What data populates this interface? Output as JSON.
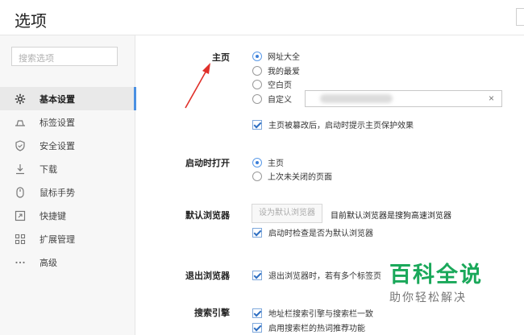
{
  "title": "选项",
  "search": {
    "placeholder": "搜索选项"
  },
  "sidebar": {
    "items": [
      {
        "label": "基本设置",
        "icon": "gear-icon",
        "active": true
      },
      {
        "label": "标签设置",
        "icon": "tab-icon",
        "active": false
      },
      {
        "label": "安全设置",
        "icon": "shield-icon",
        "active": false
      },
      {
        "label": "下载",
        "icon": "download-icon",
        "active": false
      },
      {
        "label": "鼠标手势",
        "icon": "mouse-icon",
        "active": false
      },
      {
        "label": "快捷键",
        "icon": "shortcut-icon",
        "active": false
      },
      {
        "label": "扩展管理",
        "icon": "extensions-icon",
        "active": false
      },
      {
        "label": "高级",
        "icon": "more-icon",
        "active": false
      }
    ]
  },
  "homepage": {
    "label": "主页",
    "options": [
      "网址大全",
      "我的最爱",
      "空白页",
      "自定义"
    ],
    "selected": "网址大全",
    "custom_clear": "×",
    "protect_check": "主页被篡改后，启动时提示主页保护效果"
  },
  "startup": {
    "label": "启动时打开",
    "options": [
      "主页",
      "上次未关闭的页面"
    ],
    "selected": "主页"
  },
  "default_browser": {
    "label": "默认浏览器",
    "button": "设为默认浏览器",
    "status": "目前默认浏览器是搜狗高速浏览器",
    "check_label": "启动时检查是否为默认浏览器"
  },
  "exit_browser": {
    "label": "退出浏览器",
    "check_label": "退出浏览器时，若有多个标签页"
  },
  "search_engine": {
    "label": "搜索引擎",
    "checks": [
      "地址栏搜索引擎与搜索栏一致",
      "启用搜索栏的热词推荐功能"
    ]
  },
  "watermark": {
    "big": "百科全说",
    "small": "助你轻松解决"
  },
  "colors": {
    "accent": "#4a90e2",
    "annotation_arrow": "#e0302a",
    "watermark_green": "#1aa85a"
  }
}
